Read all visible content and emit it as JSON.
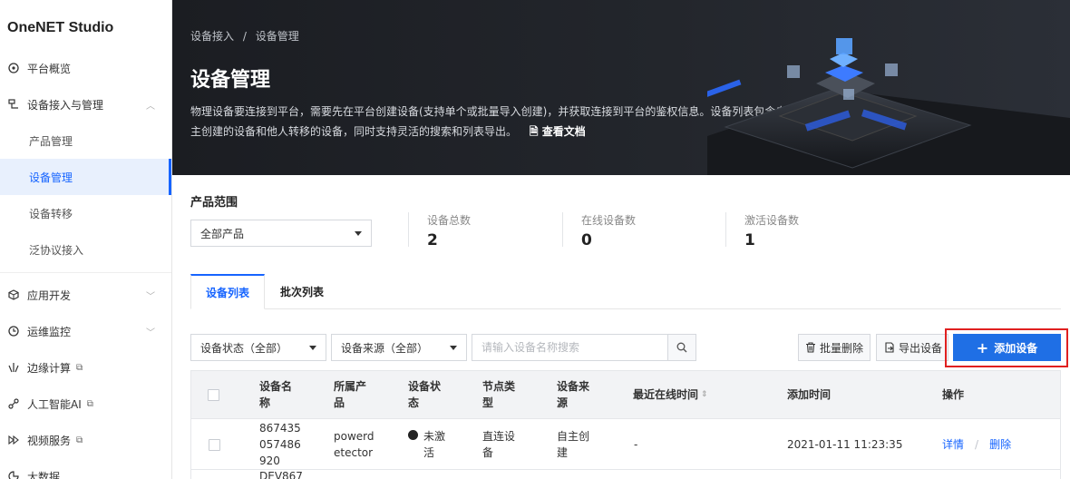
{
  "sidebar": {
    "brand": "OneNET Studio",
    "items": [
      {
        "label": "平台概览",
        "icon": "dashboard-icon"
      },
      {
        "label": "设备接入与管理",
        "icon": "device-icon",
        "expanded": true
      },
      {
        "label": "应用开发",
        "icon": "cube-icon"
      },
      {
        "label": "运维监控",
        "icon": "clock-icon"
      },
      {
        "label": "边缘计算",
        "icon": "edge-icon",
        "external": true
      },
      {
        "label": "人工智能AI",
        "icon": "ai-icon",
        "external": true
      },
      {
        "label": "视频服务",
        "icon": "video-icon",
        "external": true
      },
      {
        "label": "大数据",
        "icon": "bigdata-icon"
      }
    ],
    "subitems": [
      "产品管理",
      "设备管理",
      "设备转移",
      "泛协议接入"
    ],
    "active_sub": "设备管理"
  },
  "banner": {
    "breadcrumb": [
      "设备接入",
      "/",
      "设备管理"
    ],
    "title": "设备管理",
    "desc_line1": "物理设备要连接到平台，需要先在平台创建设备(支持单个或批量导入创建)，并获取连接到平台的鉴权信息。设备列表包含自",
    "desc_line2": "主创建的设备和他人转移的设备，同时支持灵活的搜索和列表导出。",
    "doc_link": "查看文档"
  },
  "stats": {
    "range_label": "产品范围",
    "product_select": "全部产品",
    "total_label": "设备总数",
    "total_value": "2",
    "online_label": "在线设备数",
    "online_value": "0",
    "active_label": "激活设备数",
    "active_value": "1"
  },
  "tabs": [
    "设备列表",
    "批次列表"
  ],
  "filters": {
    "status_select": "设备状态（全部）",
    "source_select": "设备来源（全部）",
    "search_placeholder": "请输入设备名称搜索",
    "batch_delete": "批量删除",
    "export": "导出设备",
    "add": "添加设备"
  },
  "table": {
    "headers": [
      "设备名\n称",
      "所属产\n品",
      "设备状\n态",
      "节点类\n型",
      "设备来\n源",
      "最近在线时间",
      "添加时间",
      "操作"
    ],
    "rows": [
      {
        "name": "867435\n057486\n920",
        "product": "powerd\netector",
        "status": "未激\n活",
        "node_type": "直连设\n备",
        "source": "自主创\n建",
        "last_online": "-",
        "added": "2021-01-11 11:23:35",
        "action_detail": "详情",
        "action_sep": "/",
        "action_delete": "删除"
      },
      {
        "name": "DEV867"
      }
    ]
  },
  "colors": {
    "accent": "#1664ff",
    "primary_button": "#1f6fe5",
    "banner_bg": "#1b1d22",
    "highlight": "#e02020"
  }
}
